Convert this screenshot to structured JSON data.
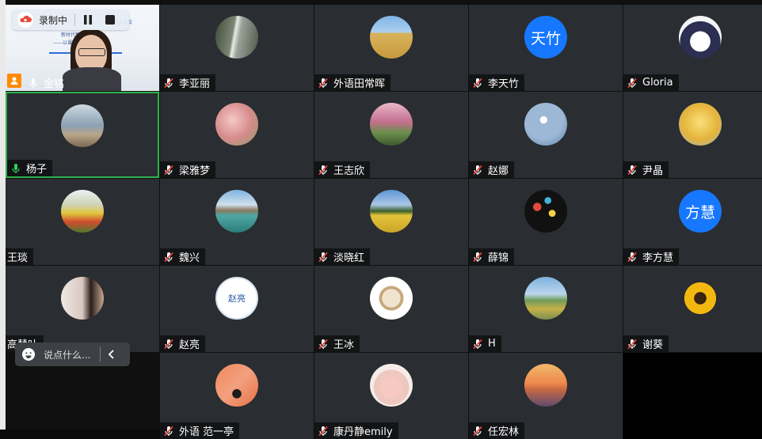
{
  "recording": {
    "label": "录制中",
    "icons": {
      "cloud": "cloud-record-icon",
      "pause": "pause-icon",
      "stop": "stop-icon"
    }
  },
  "host": {
    "name": "金铭",
    "slide_lines": [
      "新时代教学研究",
      "——以课程建设为例",
      "交流会议"
    ]
  },
  "chat": {
    "placeholder": "说点什么..."
  },
  "participants": [
    {
      "name": "李亚丽",
      "avatar": "waterfall"
    },
    {
      "name": "外语田常晖",
      "avatar": "wheat-field"
    },
    {
      "name": "李天竹",
      "avatar_text": "天竹"
    },
    {
      "name": "Gloria",
      "avatar": "anime-girl"
    },
    {
      "name": "杨子",
      "avatar": "beach-person",
      "speaking": true
    },
    {
      "name": "梁雅梦",
      "avatar": "pink-flowers"
    },
    {
      "name": "王志欣",
      "avatar": "blossom-path"
    },
    {
      "name": "赵娜",
      "avatar": "swan-lake"
    },
    {
      "name": "尹晶",
      "avatar": "yellow-flowers"
    },
    {
      "name": "王琰",
      "avatar": "tulip-field",
      "no_mic": true
    },
    {
      "name": "魏兴",
      "avatar": "lake-mountain"
    },
    {
      "name": "淡晓红",
      "avatar": "rapeseed-field"
    },
    {
      "name": "薛锦",
      "avatar": "dark-flowers"
    },
    {
      "name": "李方慧",
      "avatar_text": "方慧"
    },
    {
      "name": "高慧叶",
      "avatar": "girl-wall",
      "no_mic": true
    },
    {
      "name": "赵亮",
      "avatar_text": "赵亮",
      "avatar_style": "white"
    },
    {
      "name": "王冰",
      "avatar": "cartoon-cat"
    },
    {
      "name": "H",
      "avatar": "flower-meadow"
    },
    {
      "name": "谢葵",
      "avatar": "sunflower"
    },
    {
      "name": "外语 范一亭",
      "avatar": "orange-map"
    },
    {
      "name": "康丹静emily",
      "avatar": "pink-toy"
    },
    {
      "name": "任宏林",
      "avatar": "sunset"
    }
  ],
  "colors": {
    "tile_bg": "#2a2d31",
    "active_border": "#2fb24c",
    "accent_blue": "#1677ff",
    "host_badge": "#ff8a00"
  }
}
